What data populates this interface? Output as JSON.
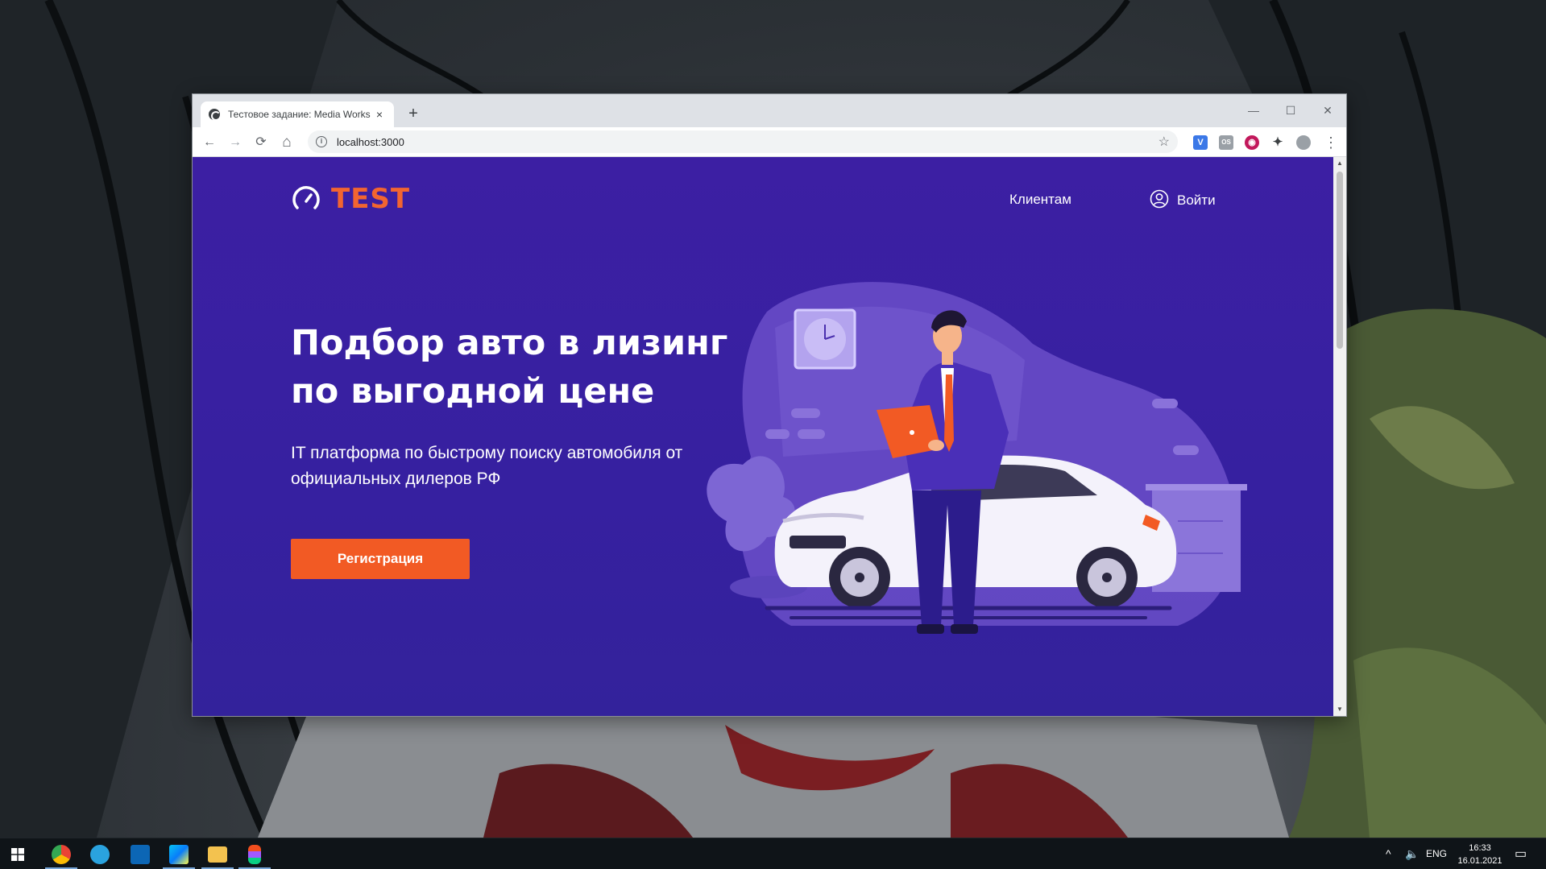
{
  "browser": {
    "tab_title": "Тестовое задание: Media Works",
    "tab_close": "×",
    "new_tab": "+",
    "url": "localhost:3000",
    "controls": {
      "minimize": "—",
      "maximize": "☐",
      "close": "✕"
    },
    "nav": {
      "back": "←",
      "forward": "→",
      "reload": "⟳",
      "home": "⌂",
      "star": "☆",
      "menu": "⋮",
      "info": "i"
    },
    "extensions": [
      "V",
      "OS",
      "◉",
      "✦"
    ]
  },
  "site": {
    "logo_text": "TEST",
    "nav": {
      "clients": "Клиентам",
      "login": "Войти"
    },
    "hero": {
      "title_line1": "Подбор авто в лизинг",
      "title_line2": "по выгодной цене",
      "subtitle_line1": "IT платформа по быстрому поиску автомобиля от",
      "subtitle_line2": "официальных дилеров РФ",
      "cta": "Регистрация"
    },
    "colors": {
      "background": "#3a1fa5",
      "accent": "#f25a24",
      "text": "#ffffff"
    }
  },
  "taskbar": {
    "apps": [
      "windows-start",
      "chrome",
      "telegram",
      "trello",
      "webstorm",
      "file-explorer",
      "figma"
    ],
    "language": "ENG",
    "time": "16:33",
    "date": "16.01.2021"
  }
}
